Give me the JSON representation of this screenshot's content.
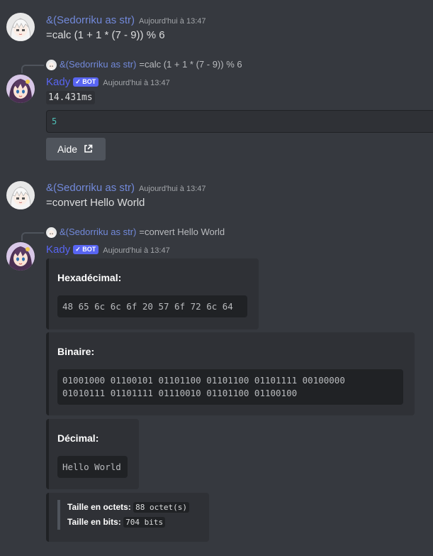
{
  "messages": [
    {
      "username": "&(Sedorriku as str)",
      "timestamp": "Aujourd'hui à 13:47",
      "text": "=calc (1 + 1 * (7 - 9)) % 6"
    },
    {
      "reply": {
        "username": "&(Sedorriku as str)",
        "text": "=calc (1 + 1 * (7 - 9)) % 6"
      },
      "username": "Kady",
      "bot_tag": "✓ BOT",
      "timestamp": "Aujourd'hui à 13:47",
      "inline_code": "14.431ms",
      "code_block": "5",
      "button_label": "Aide"
    },
    {
      "username": "&(Sedorriku as str)",
      "timestamp": "Aujourd'hui à 13:47",
      "text": "=convert Hello World"
    },
    {
      "reply": {
        "username": "&(Sedorriku as str)",
        "text": "=convert Hello World"
      },
      "username": "Kady",
      "bot_tag": "✓ BOT",
      "timestamp": "Aujourd'hui à 13:47",
      "embeds": [
        {
          "title": "Hexadécimal:",
          "code": "48 65 6c 6c 6f 20 57 6f 72 6c 64"
        },
        {
          "title": "Binaire:",
          "code": "01001000 01100101 01101100 01101100 01101111 00100000\n01010111 01101111 01110010 01101100 01100100"
        },
        {
          "title": "Décimal:",
          "code": "Hello World"
        },
        {
          "size_octets_label": "Taille en octets:",
          "size_octets_value": "88 octet(s)",
          "size_bits_label": "Taille en bits:",
          "size_bits_value": "704 bits"
        }
      ]
    }
  ],
  "colors": {
    "background": "#36393f",
    "embed_bg": "#2f3136",
    "code_bg": "#202225",
    "username_user": "#7289da",
    "username_bot": "#5865f2",
    "bot_tag": "#5865f2",
    "button": "#4f545c",
    "code_result": "#4fc1b8"
  },
  "icons": [
    "avatar-sedorriku",
    "avatar-kady",
    "external-link-icon",
    "verified-check-icon"
  ]
}
